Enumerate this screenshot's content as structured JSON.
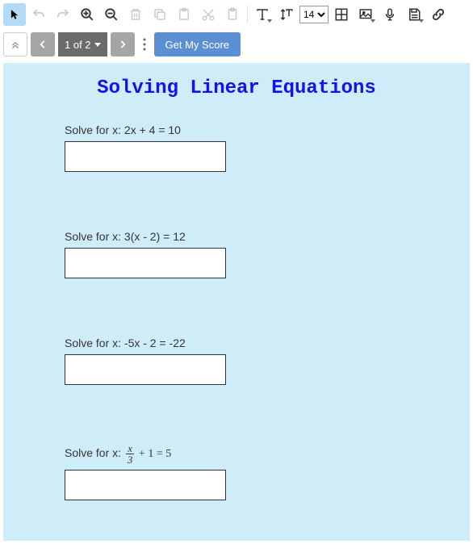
{
  "toolbar": {
    "font_size": "14"
  },
  "nav": {
    "page_label": "1 of 2",
    "score_label": "Get My Score"
  },
  "worksheet": {
    "title": "Solving Linear Equations",
    "problems": [
      {
        "prompt": "Solve for x: 2x + 4 = 10"
      },
      {
        "prompt": "Solve for x: 3(x - 2) = 12"
      },
      {
        "prompt": "Solve for x: -5x - 2 = -22"
      },
      {
        "prompt_prefix": "Solve for x: ",
        "frac_num": "x",
        "frac_den": "3",
        "frac_rest": " + 1 = 5"
      }
    ]
  }
}
